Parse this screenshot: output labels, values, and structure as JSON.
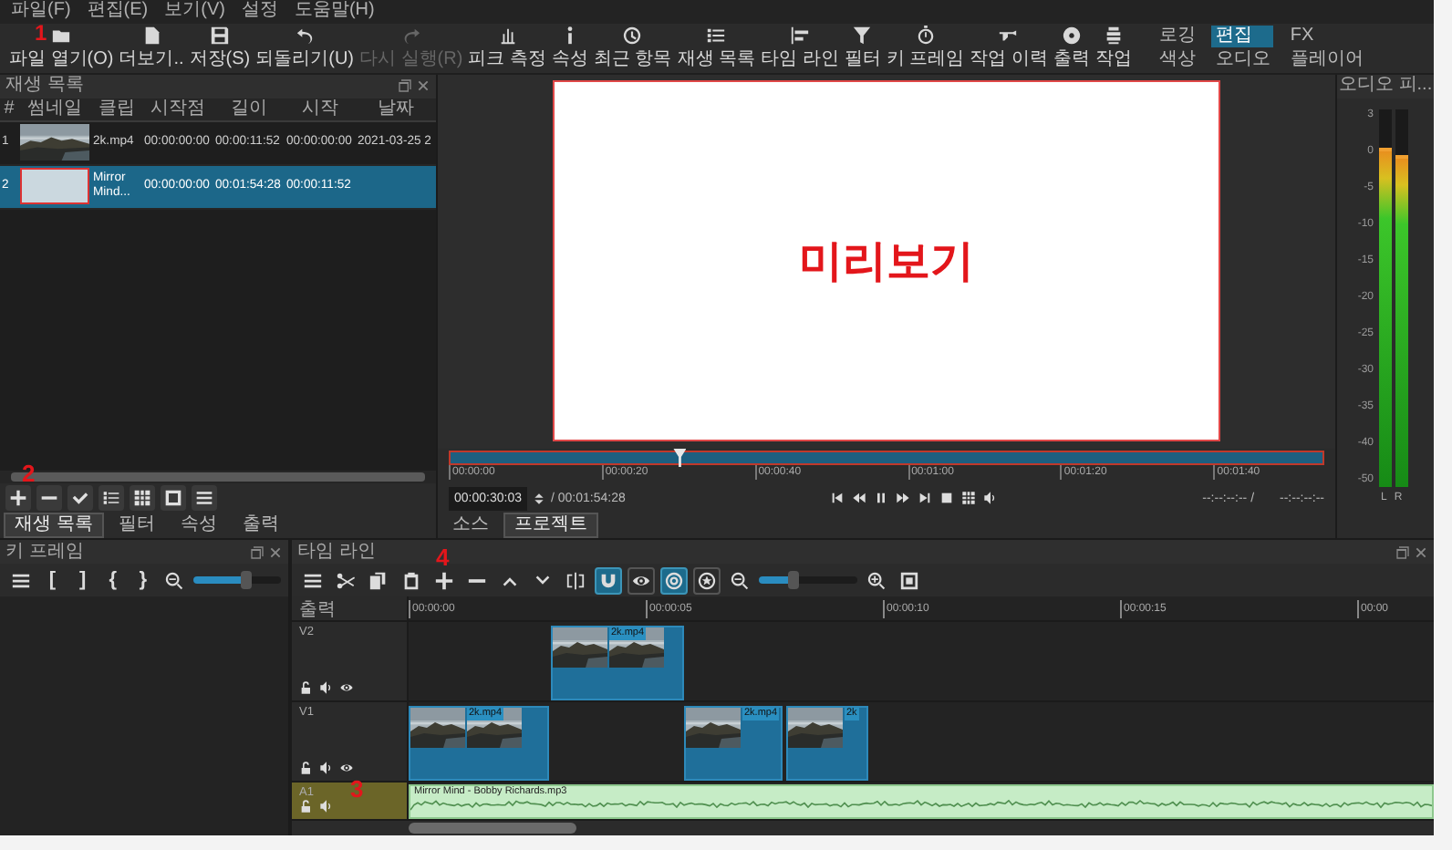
{
  "menu": [
    "파일(F)",
    "편집(E)",
    "보기(V)",
    "설정",
    "도움말(H)"
  ],
  "toolbar": [
    {
      "kind": "open",
      "label": "파일 열기(O)",
      "disabled": false,
      "annotation": "1"
    },
    {
      "kind": "more",
      "label": "더보기..",
      "disabled": false
    },
    {
      "kind": "save",
      "label": "저장(S)",
      "disabled": false
    },
    {
      "kind": "undo",
      "label": "되돌리기(U)",
      "disabled": false
    },
    {
      "kind": "redo",
      "label": "다시 실행(R)",
      "disabled": true
    },
    {
      "kind": "peak",
      "label": "피크 측정",
      "disabled": false
    },
    {
      "kind": "properties",
      "label": "속성",
      "disabled": false
    },
    {
      "kind": "recent",
      "label": "최근 항목",
      "disabled": false
    },
    {
      "kind": "playlist",
      "label": "재생 목록",
      "disabled": false
    },
    {
      "kind": "timeline",
      "label": "타임 라인",
      "disabled": false
    },
    {
      "kind": "filters",
      "label": "필터",
      "disabled": false
    },
    {
      "kind": "keyframes",
      "label": "키 프레임",
      "disabled": false
    },
    {
      "kind": "history",
      "label": "작업 이력",
      "disabled": false
    },
    {
      "kind": "export",
      "label": "출력",
      "disabled": false
    },
    {
      "kind": "jobs",
      "label": "작업",
      "disabled": false
    }
  ],
  "layouts": [
    {
      "label": "로깅",
      "selected": false
    },
    {
      "label": "편집",
      "selected": true
    },
    {
      "label": "FX",
      "selected": false
    },
    {
      "label": "색상",
      "selected": false
    },
    {
      "label": "오디오",
      "selected": false
    },
    {
      "label": "플레이어",
      "selected": false
    }
  ],
  "playlist": {
    "title": "재생 목록",
    "columns": [
      "#",
      "썸네일",
      "클립",
      "시작점",
      "길이",
      "시작",
      "날짜"
    ],
    "rows": [
      {
        "number": "1",
        "clip": "2k.mp4",
        "in": "00:00:00:00",
        "duration": "00:00:11:52",
        "start": "00:00:00:00",
        "date": "2021-03-25 2",
        "selected": false
      },
      {
        "number": "2",
        "thumbnail": {
          "kind": "blank"
        },
        "clip": "Mirror Mind...",
        "in": "00:00:00:00",
        "duration": "00:01:54:28",
        "start": "00:00:11:52",
        "selected": true
      }
    ],
    "annotation": "2",
    "buttons": [
      {
        "kind": "add"
      },
      {
        "kind": "remove"
      },
      {
        "kind": "update"
      },
      {
        "kind": "details"
      },
      {
        "kind": "tiles"
      },
      {
        "kind": "icons"
      },
      {
        "kind": "menu"
      }
    ],
    "tabs": [
      {
        "label": "재생 목록",
        "selected": true
      },
      {
        "label": "필터",
        "selected": false
      },
      {
        "label": "속성",
        "selected": false
      },
      {
        "label": "출력",
        "selected": false
      }
    ]
  },
  "player": {
    "preview_text": "미리보기",
    "ruler": [
      "00:00:00",
      "00:00:20",
      "00:00:40",
      "00:01:00",
      "00:01:20",
      "00:01:40"
    ],
    "playhead": {
      "level": 0.262
    },
    "position": "00:00:30:03",
    "duration": "/ 00:01:54:28",
    "controls": [
      {
        "kind": "skip-start"
      },
      {
        "kind": "rewind"
      },
      {
        "kind": "pause"
      },
      {
        "kind": "fast-forward"
      },
      {
        "kind": "skip-end"
      },
      {
        "kind": "stop"
      },
      {
        "kind": "grid"
      },
      {
        "kind": "volume"
      }
    ],
    "in_point": "--:--:--:-- /",
    "out_point": "--:--:--:--",
    "tabs": [
      {
        "label": "소스",
        "selected": false
      },
      {
        "label": "프로젝트",
        "selected": true
      }
    ]
  },
  "audio_meter": {
    "title": "오디오 피...",
    "scale": [
      "3",
      "0",
      "-5",
      "-10",
      "-15",
      "-20",
      "-25",
      "-30",
      "-35",
      "-40",
      "-50"
    ],
    "channels": [
      {
        "name": "L",
        "level": 0.9
      },
      {
        "name": "R",
        "level": 0.88
      }
    ]
  },
  "keyframes": {
    "title": "키 프레임",
    "tools": [
      {
        "kind": "menu"
      },
      {
        "kind": "glyph",
        "text": "["
      },
      {
        "kind": "glyph",
        "text": "]"
      },
      {
        "kind": "glyph",
        "text": "{"
      },
      {
        "kind": "glyph",
        "text": "}"
      },
      {
        "kind": "zoom-out"
      },
      {
        "kind": "zoom-slider",
        "level": 0.6
      }
    ]
  },
  "timeline": {
    "title": "타임 라인",
    "tools": [
      {
        "kind": "menu"
      },
      {
        "kind": "cut"
      },
      {
        "kind": "copy"
      },
      {
        "kind": "paste"
      },
      {
        "kind": "append",
        "annotation": "4"
      },
      {
        "kind": "remove"
      },
      {
        "kind": "lift"
      },
      {
        "kind": "overwrite"
      },
      {
        "kind": "split"
      },
      {
        "kind": "snap",
        "on": true
      },
      {
        "kind": "scrub",
        "on": false
      },
      {
        "kind": "ripple",
        "on": true
      },
      {
        "kind": "ripple-all",
        "on": false
      },
      {
        "kind": "zoom-out"
      },
      {
        "kind": "zoom-slider",
        "level": 0.35
      },
      {
        "kind": "zoom-in"
      },
      {
        "kind": "fit"
      }
    ],
    "output_label": "출력",
    "ruler": [
      "00:00:00",
      "00:00:05",
      "00:00:10",
      "00:00:15",
      "00:00"
    ],
    "tracks": [
      {
        "name": "V2",
        "kind": "video",
        "selected": false,
        "clips": [
          {
            "label": "2k.mp4"
          }
        ]
      },
      {
        "name": "V1",
        "kind": "video",
        "selected": false,
        "clips": [
          {
            "label": "2k.mp4"
          },
          {
            "label": "2k.mp4"
          },
          {
            "label": "2k"
          }
        ]
      },
      {
        "name": "A1",
        "kind": "audio",
        "selected": true,
        "annotation": "3",
        "clips": [
          {
            "label": "Mirror Mind - Bobby Richards.mp3"
          }
        ]
      }
    ]
  }
}
